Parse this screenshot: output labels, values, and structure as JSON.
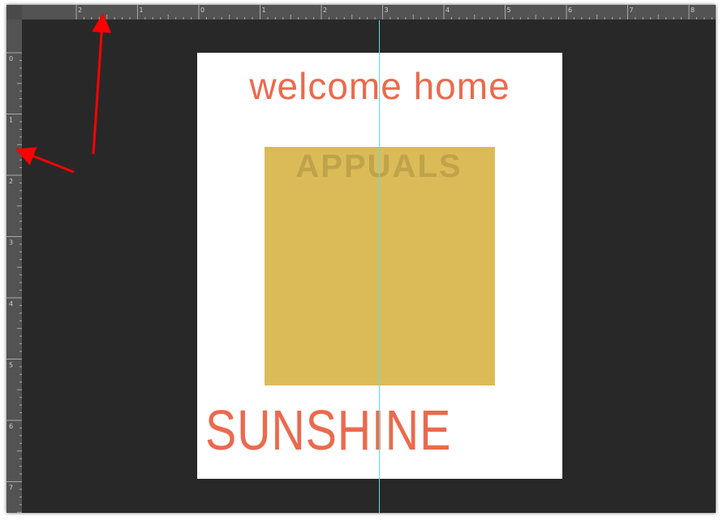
{
  "rulers": {
    "top_labels": [
      "2",
      "1",
      "0",
      "1",
      "2",
      "3",
      "4",
      "5",
      "6",
      "7",
      "8"
    ],
    "left_labels": [
      "0",
      "1",
      "2",
      "3",
      "4",
      "5",
      "6",
      "7"
    ]
  },
  "artboard": {
    "headline": "welcome home",
    "footer_word": "SUNSHINE",
    "watermark": "APPUALS"
  },
  "colors": {
    "canvas_bg": "#282828",
    "ruler_bg": "#535353",
    "text_accent": "#ea6a4e",
    "block_fill": "#dbbb58",
    "guide": "#56e0e6",
    "annotation_arrow": "#ff0000"
  },
  "annotations": {
    "arrow_count": 2
  }
}
